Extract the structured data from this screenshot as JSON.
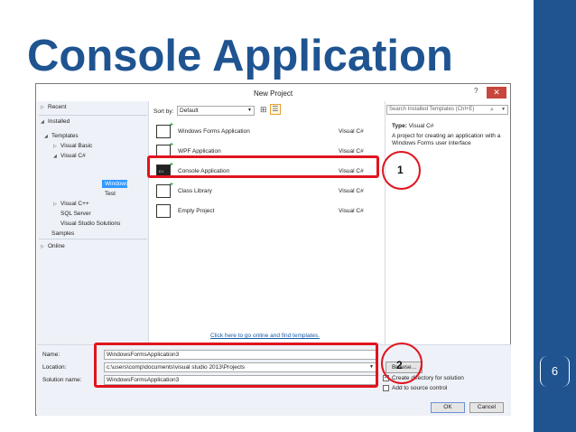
{
  "slide": {
    "title": "Console Application",
    "page_number": "6",
    "colors": {
      "title": "#1f5491",
      "side_bar": "#1f5491",
      "highlight": "#e0141e"
    }
  },
  "dialog": {
    "title": "New Project",
    "help_glyph": "?",
    "close_glyph": "✕",
    "tree": {
      "recent": "Recent",
      "installed": "Installed",
      "templates": "Templates",
      "visual_basic": "Visual Basic",
      "visual_csharp": "Visual C#",
      "windows": "Windows",
      "test": "Test",
      "visual_cpp": "Visual C++",
      "sql_server": "SQL Server",
      "visual_studio_solutions": "Visual Studio Solutions",
      "samples": "Samples",
      "online": "Online"
    },
    "toolbar": {
      "sort_by_label": "Sort by:",
      "sort_by_value": "Default"
    },
    "templates": [
      {
        "name": "Windows Forms Application",
        "lang": "Visual C#"
      },
      {
        "name": "WPF Application",
        "lang": "Visual C#"
      },
      {
        "name": "Console Application",
        "lang": "Visual C#"
      },
      {
        "name": "Class Library",
        "lang": "Visual C#"
      },
      {
        "name": "Empty Project",
        "lang": "Visual C#"
      }
    ],
    "online_link": "Click here to go online and find templates.",
    "search_placeholder": "Search Installed Templates (Ctrl+E)",
    "details": {
      "type_label": "Type:",
      "type_value": "Visual C#",
      "description": "A project for creating an application with a Windows Forms user interface"
    },
    "form": {
      "name_label": "Name:",
      "name_value": "WindowsFormsApplication3",
      "location_label": "Location:",
      "location_value": "c:\\users\\comp\\documents\\visual studio 2013\\Projects",
      "solution_label": "Solution name:",
      "solution_value": "WindowsFormsApplication3",
      "browse_label": "Browse...",
      "create_dir_label": "Create directory for solution",
      "create_dir_checked": true,
      "add_source_label": "Add to source control",
      "add_source_checked": false,
      "ok_label": "OK",
      "cancel_label": "Cancel"
    }
  },
  "callouts": {
    "one": "1",
    "two": "2"
  }
}
